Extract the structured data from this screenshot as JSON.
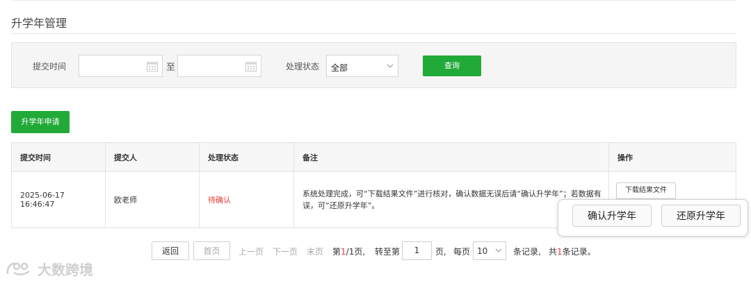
{
  "page_title": "升学年管理",
  "filter": {
    "submit_time_label": "提交时间",
    "range_separator": "至",
    "start_date_value": "",
    "end_date_value": "",
    "status_label": "处理状态",
    "status_value": "全部",
    "query_button": "查询"
  },
  "apply_button": "升学年申请",
  "table": {
    "headers": [
      "提交时间",
      "提交人",
      "处理状态",
      "备注",
      "操作"
    ],
    "rows": [
      {
        "submit_time": "2025-06-17 16:46:47",
        "submitter": "欧老师",
        "status": "待确认",
        "note": "系统处理完成，可“下载结果文件”进行核对，确认数据无误后请“确认升学年”；若数据有误，可“还原升学年”。",
        "action_label": "下载结果文件"
      }
    ]
  },
  "popup": {
    "confirm_button": "确认升学年",
    "restore_button": "还原升学年"
  },
  "pagination": {
    "back": "返回",
    "first": "首页",
    "prev": "上一页",
    "next": "下一页",
    "last": "末页",
    "page_prefix": "第",
    "current_page": "1",
    "page_sep": "/",
    "total_pages": "1",
    "page_suffix": "页,",
    "goto_prefix": "转至第",
    "goto_value": "1",
    "goto_suffix": "页,",
    "per_page_prefix": "每页",
    "per_page_value": "10",
    "records_suffix": "条记录,",
    "total_prefix": "共",
    "total_records": "1",
    "total_suffix": "条记录。"
  },
  "watermark": "大数跨境",
  "colors": {
    "accent_green": "#22aa38",
    "status_red": "#e53935"
  }
}
